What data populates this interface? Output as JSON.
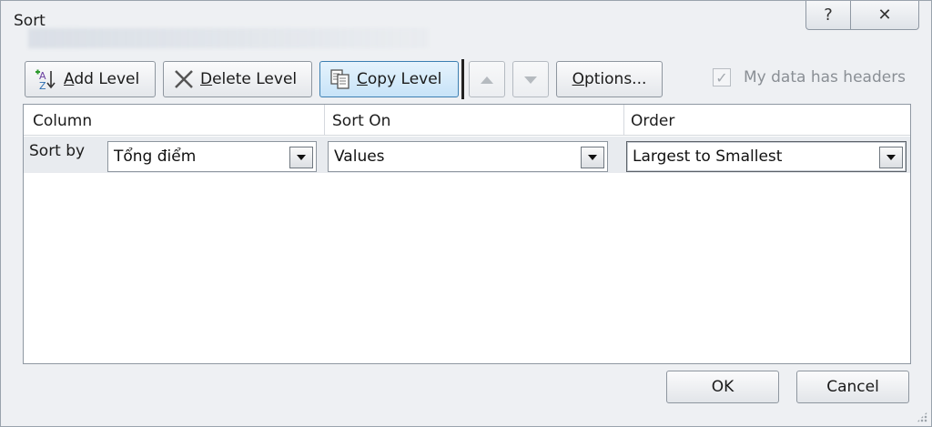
{
  "window": {
    "title": "Sort",
    "help_glyph": "?",
    "close_glyph": "✕"
  },
  "toolbar": {
    "add_level": {
      "underlined": "A",
      "rest": "dd Level",
      "icon": "sort-az-add-icon"
    },
    "delete_level": {
      "underlined": "D",
      "rest": "elete Level",
      "icon": "delete-x-icon"
    },
    "copy_level": {
      "underlined": "C",
      "rest": "opy Level",
      "icon": "copy-icon"
    },
    "move_up": {
      "icon": "triangle-up-icon"
    },
    "move_down": {
      "icon": "triangle-down-icon"
    },
    "options": {
      "underlined": "O",
      "rest": "ptions..."
    },
    "headers_checkbox": {
      "before": "My data has ",
      "underlined": "h",
      "after": "eaders",
      "checked": true,
      "enabled": false
    }
  },
  "grid": {
    "columns": [
      "Column",
      "Sort On",
      "Order"
    ],
    "rows": [
      {
        "label": "Sort by",
        "column": "Tổng điểm",
        "sort_on": "Values",
        "order": "Largest to Smallest"
      }
    ]
  },
  "buttons": {
    "ok": "OK",
    "cancel": "Cancel"
  },
  "colors": {
    "dialog_bg": "#eef0f3",
    "active_button": "#c7e3f8",
    "active_border": "#3c7fb1"
  }
}
